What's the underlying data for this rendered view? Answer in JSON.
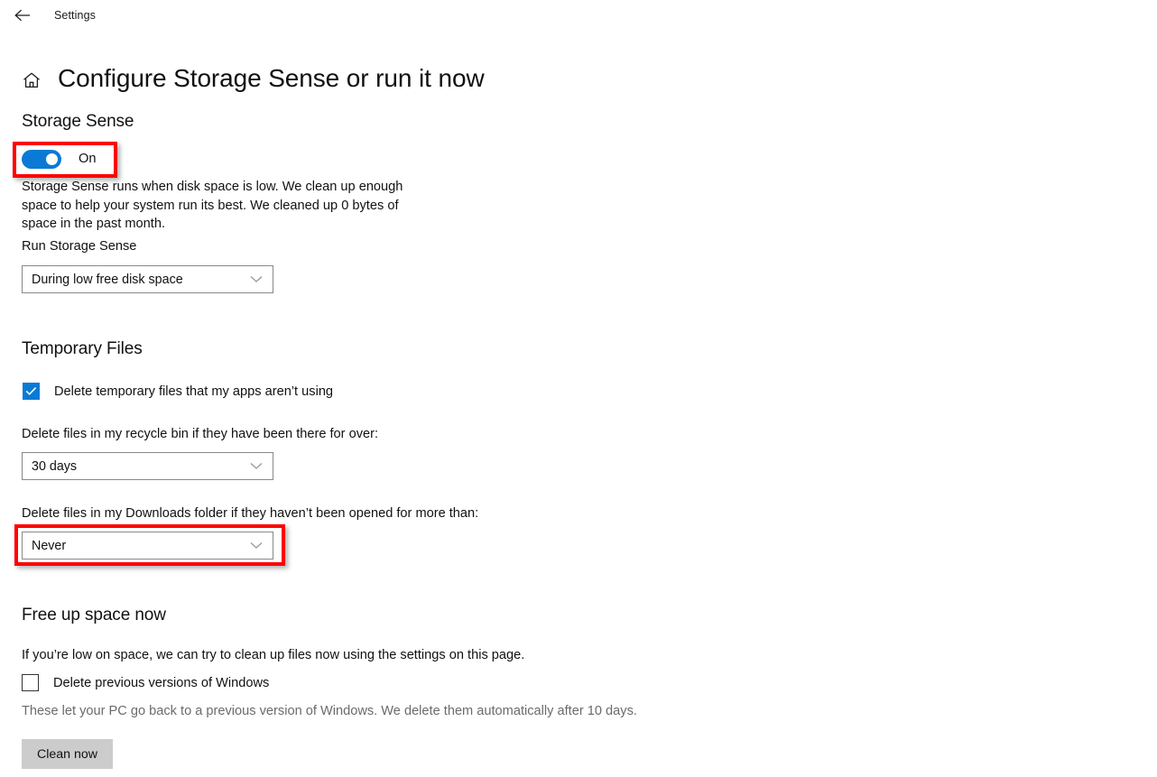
{
  "window": {
    "back_button_icon": "arrow-left-icon",
    "app_name": "Settings"
  },
  "header": {
    "home_icon": "home-icon",
    "title": "Configure Storage Sense or run it now"
  },
  "storage_sense": {
    "heading": "Storage Sense",
    "toggle": {
      "state_label": "On",
      "checked": true,
      "accent_color": "#0a7ad6",
      "highlighted": true
    },
    "description": "Storage Sense runs when disk space is low. We clean up enough space to help your system run its best. We cleaned up 0 bytes of space in the past month.",
    "run_label": "Run Storage Sense",
    "run_dropdown": {
      "value": "During low free disk space",
      "chevron_icon": "chevron-down-icon"
    }
  },
  "temporary_files": {
    "heading": "Temporary Files",
    "temp_checkbox": {
      "label": "Delete temporary files that my apps aren’t using",
      "checked": true
    },
    "recycle_label": "Delete files in my recycle bin if they have been there for over:",
    "recycle_dropdown": {
      "value": "30 days",
      "chevron_icon": "chevron-down-icon"
    },
    "downloads_label": "Delete files in my Downloads folder if they haven’t been opened for more than:",
    "downloads_dropdown": {
      "value": "Never",
      "chevron_icon": "chevron-down-icon",
      "highlighted": true
    }
  },
  "free_up_space": {
    "heading": "Free up space now",
    "description": "If you’re low on space, we can try to clean up files now using the settings on this page.",
    "prev_versions_checkbox": {
      "label": "Delete previous versions of Windows",
      "checked": false
    },
    "prev_versions_note": "These let your PC go back to a previous version of Windows. We delete them automatically after 10 days.",
    "clean_now_button": "Clean now"
  },
  "highlight": {
    "color": "#fe0000"
  }
}
